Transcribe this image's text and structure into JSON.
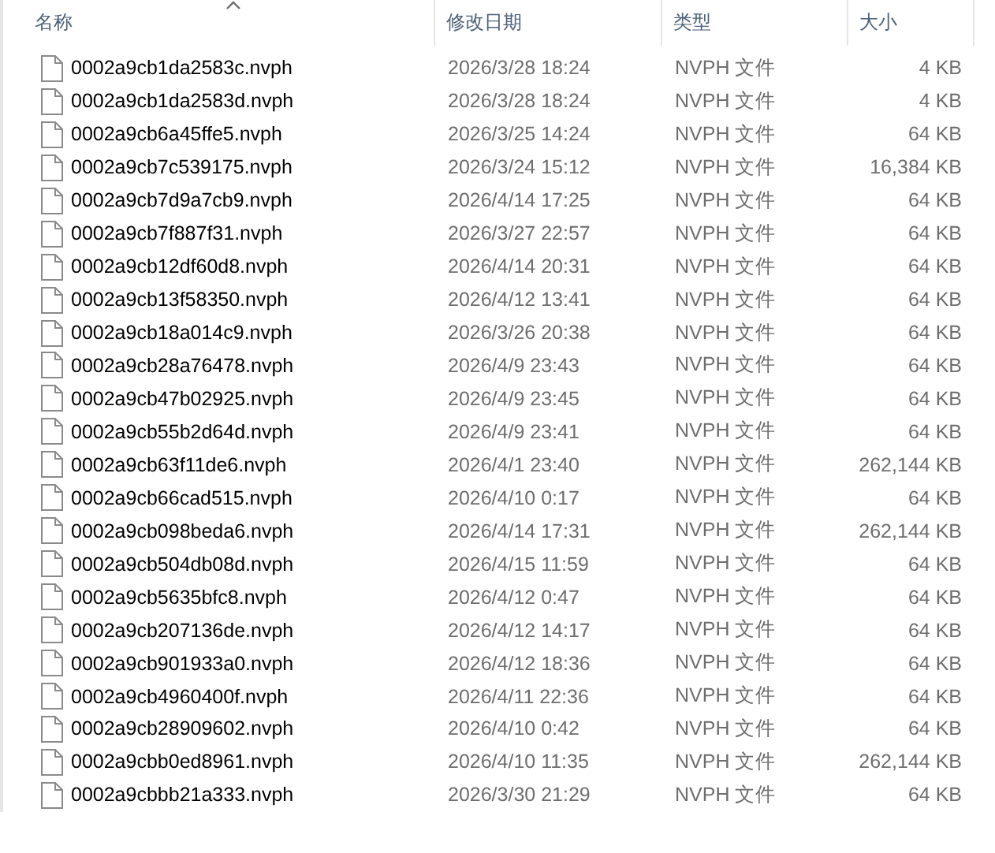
{
  "columns": [
    {
      "label": "名称",
      "sorted": true
    },
    {
      "label": "修改日期",
      "sorted": false
    },
    {
      "label": "类型",
      "sorted": false
    },
    {
      "label": "大小",
      "sorted": false
    }
  ],
  "files": [
    {
      "name": "0002a9cb1da2583c.nvph",
      "modified": "2026/3/28 18:24",
      "type": "NVPH 文件",
      "size": "4 KB"
    },
    {
      "name": "0002a9cb1da2583d.nvph",
      "modified": "2026/3/28 18:24",
      "type": "NVPH 文件",
      "size": "4 KB"
    },
    {
      "name": "0002a9cb6a45ffe5.nvph",
      "modified": "2026/3/25 14:24",
      "type": "NVPH 文件",
      "size": "64 KB"
    },
    {
      "name": "0002a9cb7c539175.nvph",
      "modified": "2026/3/24 15:12",
      "type": "NVPH 文件",
      "size": "16,384 KB"
    },
    {
      "name": "0002a9cb7d9a7cb9.nvph",
      "modified": "2026/4/14 17:25",
      "type": "NVPH 文件",
      "size": "64 KB"
    },
    {
      "name": "0002a9cb7f887f31.nvph",
      "modified": "2026/3/27 22:57",
      "type": "NVPH 文件",
      "size": "64 KB"
    },
    {
      "name": "0002a9cb12df60d8.nvph",
      "modified": "2026/4/14 20:31",
      "type": "NVPH 文件",
      "size": "64 KB"
    },
    {
      "name": "0002a9cb13f58350.nvph",
      "modified": "2026/4/12 13:41",
      "type": "NVPH 文件",
      "size": "64 KB"
    },
    {
      "name": "0002a9cb18a014c9.nvph",
      "modified": "2026/3/26 20:38",
      "type": "NVPH 文件",
      "size": "64 KB"
    },
    {
      "name": "0002a9cb28a76478.nvph",
      "modified": "2026/4/9 23:43",
      "type": "NVPH 文件",
      "size": "64 KB"
    },
    {
      "name": "0002a9cb47b02925.nvph",
      "modified": "2026/4/9 23:45",
      "type": "NVPH 文件",
      "size": "64 KB"
    },
    {
      "name": "0002a9cb55b2d64d.nvph",
      "modified": "2026/4/9 23:41",
      "type": "NVPH 文件",
      "size": "64 KB"
    },
    {
      "name": "0002a9cb63f11de6.nvph",
      "modified": "2026/4/1 23:40",
      "type": "NVPH 文件",
      "size": "262,144 KB"
    },
    {
      "name": "0002a9cb66cad515.nvph",
      "modified": "2026/4/10 0:17",
      "type": "NVPH 文件",
      "size": "64 KB"
    },
    {
      "name": "0002a9cb098beda6.nvph",
      "modified": "2026/4/14 17:31",
      "type": "NVPH 文件",
      "size": "262,144 KB"
    },
    {
      "name": "0002a9cb504db08d.nvph",
      "modified": "2026/4/15 11:59",
      "type": "NVPH 文件",
      "size": "64 KB"
    },
    {
      "name": "0002a9cb5635bfc8.nvph",
      "modified": "2026/4/12 0:47",
      "type": "NVPH 文件",
      "size": "64 KB"
    },
    {
      "name": "0002a9cb207136de.nvph",
      "modified": "2026/4/12 14:17",
      "type": "NVPH 文件",
      "size": "64 KB"
    },
    {
      "name": "0002a9cb901933a0.nvph",
      "modified": "2026/4/12 18:36",
      "type": "NVPH 文件",
      "size": "64 KB"
    },
    {
      "name": "0002a9cb4960400f.nvph",
      "modified": "2026/4/11 22:36",
      "type": "NVPH 文件",
      "size": "64 KB"
    },
    {
      "name": "0002a9cb28909602.nvph",
      "modified": "2026/4/10 0:42",
      "type": "NVPH 文件",
      "size": "64 KB"
    },
    {
      "name": "0002a9cbb0ed8961.nvph",
      "modified": "2026/4/10 11:35",
      "type": "NVPH 文件",
      "size": "262,144 KB"
    },
    {
      "name": "0002a9cbbb21a333.nvph",
      "modified": "2026/3/30 21:29",
      "type": "NVPH 文件",
      "size": "64 KB"
    }
  ]
}
